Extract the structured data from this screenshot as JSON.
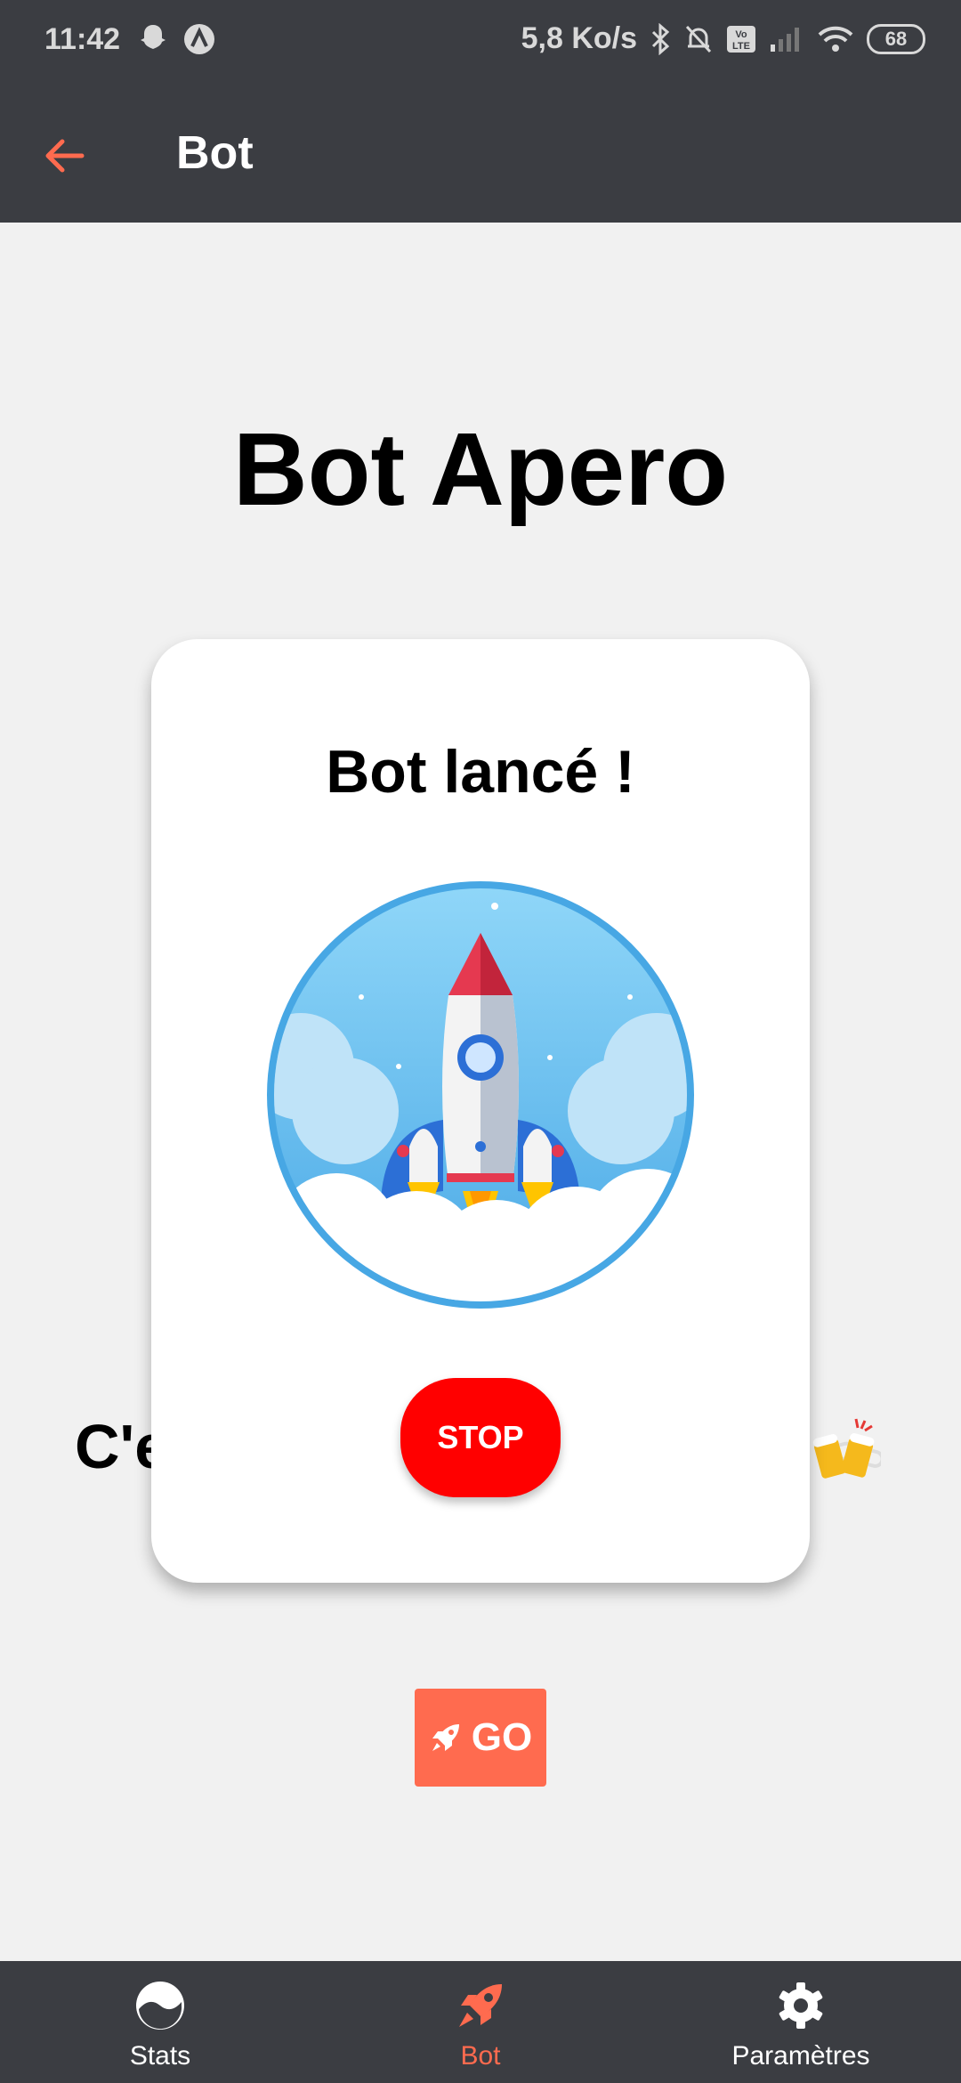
{
  "status_bar": {
    "time": "11:42",
    "network_speed": "5,8 Ko/s",
    "volte": "Vo LTE",
    "battery": "68",
    "icons": [
      "snapchat-icon",
      "app-icon",
      "bluetooth-icon",
      "mute-icon",
      "signal-icon",
      "wifi-icon",
      "battery-icon"
    ]
  },
  "app_bar": {
    "title": "Bot",
    "back_icon": "arrow-left-icon"
  },
  "main": {
    "page_title": "Bot Apero",
    "background_text": "C'e",
    "go_label": "GO"
  },
  "dialog": {
    "title": "Bot lancé !",
    "stop_label": "STOP"
  },
  "bottom_nav": {
    "items": [
      {
        "label": "Stats",
        "icon": "stats-icon",
        "active": false
      },
      {
        "label": "Bot",
        "icon": "rocket-icon",
        "active": true
      },
      {
        "label": "Paramètres",
        "icon": "gear-icon",
        "active": false
      }
    ]
  },
  "colors": {
    "accent": "#ff6b4f",
    "stop": "#ff0000",
    "bar": "#3b3d42"
  }
}
